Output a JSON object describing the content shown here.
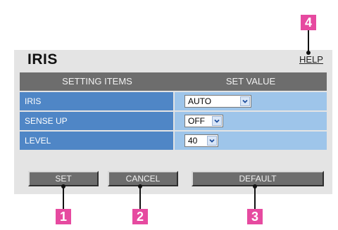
{
  "page": {
    "title": "IRIS",
    "help_label": "HELP"
  },
  "table": {
    "headers": [
      "SETTING ITEMS",
      "SET VALUE"
    ],
    "rows": [
      {
        "label": "IRIS",
        "value": "AUTO"
      },
      {
        "label": "SENSE UP",
        "value": "OFF"
      },
      {
        "label": "LEVEL",
        "value": "40"
      }
    ]
  },
  "buttons": {
    "set": "SET",
    "cancel": "CANCEL",
    "default": "DEFAULT"
  },
  "callouts": [
    "1",
    "2",
    "3",
    "4"
  ],
  "colors": {
    "panel_bg": "#e4e4e4",
    "header_bg": "#6d6d6d",
    "name_cell_bg": "#4f86c6",
    "value_cell_bg": "#9ec5ea",
    "callout_bg": "#e64aa0"
  },
  "icons": {
    "dropdown": "chevron-down-icon"
  }
}
